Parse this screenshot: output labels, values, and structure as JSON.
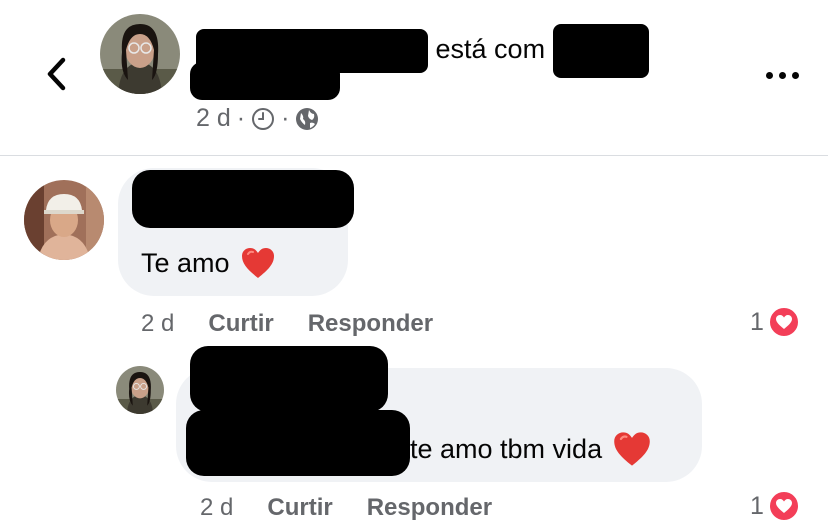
{
  "header": {
    "back_icon": "chevron-left-icon",
    "title_suffix": "está com",
    "time": "2 d",
    "separator": "·",
    "clock_icon": "clock-icon",
    "privacy_icon": "globe-icon",
    "more_icon": "more-horizontal-icon"
  },
  "comments": [
    {
      "text": "Te amo",
      "time": "2 d",
      "like_label": "Curtir",
      "reply_label": "Responder",
      "reaction_count": "1",
      "reaction_icon": "love-reaction-icon"
    },
    {
      "text": "te amo tbm vida",
      "time": "2 d",
      "like_label": "Curtir",
      "reply_label": "Responder",
      "reaction_count": "1",
      "reaction_icon": "love-reaction-icon"
    }
  ],
  "colors": {
    "bubble": "#f0f2f5",
    "secondary_text": "#65676b",
    "love_reaction": "#f33e58",
    "divider": "#dadde1"
  }
}
